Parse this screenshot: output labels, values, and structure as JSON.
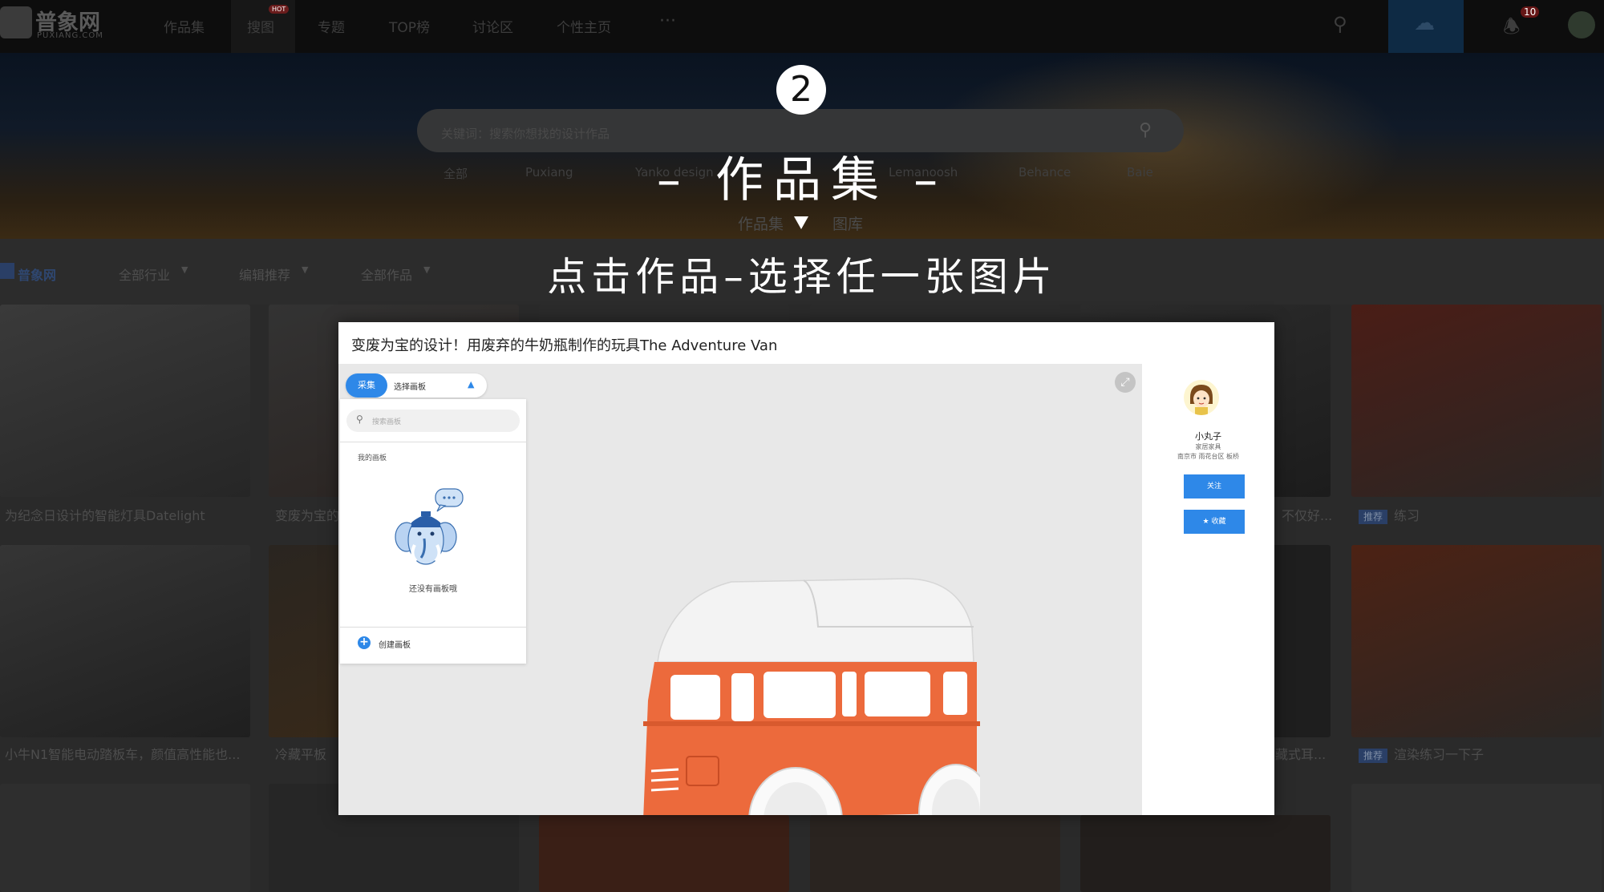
{
  "app": {
    "logo_cn": "普象网",
    "logo_en": "PUXIANG.COM"
  },
  "nav": {
    "items": [
      "作品集",
      "搜图",
      "专题",
      "TOP榜",
      "讨论区",
      "个性主页"
    ],
    "more": "···",
    "hot_badge": "HOT",
    "notification_count": "10"
  },
  "hero": {
    "search_placeholder": "关键词：搜索你想找的设计作品",
    "filters": [
      "全部",
      "Puxiang",
      "Yanko design",
      "Lemanoosh",
      "Behance",
      "Baie"
    ],
    "subtabs": [
      "作品集",
      "图库"
    ]
  },
  "filterbar": {
    "brand": "普象网",
    "items": [
      "全部行业",
      "编辑推荐",
      "全部作品"
    ]
  },
  "grid": {
    "row1_captions": [
      "为纪念日设计的智能灯具Datelight",
      "变废为宝的",
      "",
      "",
      "不仅好...",
      "练习"
    ],
    "row2_captions": [
      "小牛N1智能电动踏板车，颜值高性能也...",
      "冷藏平板",
      "",
      "",
      "藏式耳...",
      "渲染练习一下子"
    ],
    "tag": "推荐"
  },
  "overlay": {
    "step_number": "2",
    "title": "– 作品集 –",
    "instruction": "点击作品–选择任一张图片"
  },
  "dialog": {
    "title": "变废为宝的设计！用废弃的牛奶瓶制作的玩具The Adventure Van",
    "collect_label": "采集",
    "select_board_label": "选择画板",
    "board_search_placeholder": "搜索画板",
    "my_boards_label": "我的画板",
    "empty_boards_text": "还没有画板哦",
    "create_board_label": "创建画板",
    "user": {
      "name": "小丸子",
      "category": "家居家具",
      "location": "南京市 雨花台区 板桥"
    },
    "follow_label": "关注",
    "favorite_label": "★ 收藏"
  },
  "colors": {
    "accent": "#2e88e8",
    "van_body": "#ec6a3c",
    "van_roof": "#f2f2f2"
  }
}
